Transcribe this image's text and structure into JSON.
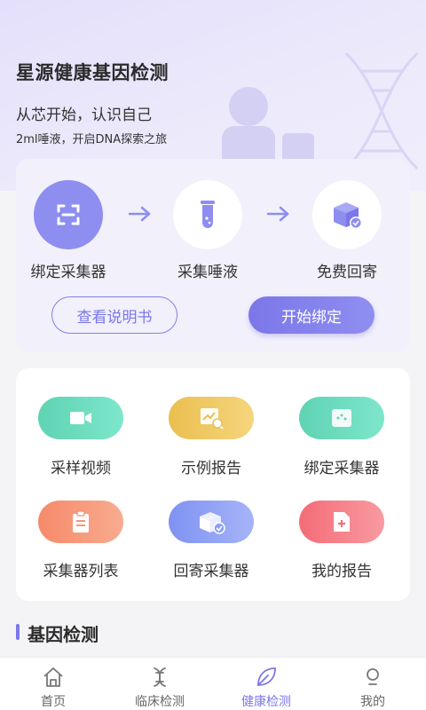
{
  "hero": {
    "title": "星源健康基因检测",
    "subtitle": "从芯开始，认识自己",
    "tagline": "2ml唾液，开启DNA探索之旅"
  },
  "bind_steps": [
    {
      "label": "绑定采集器",
      "icon": "scan-icon"
    },
    {
      "label": "采集唾液",
      "icon": "test-tube-icon"
    },
    {
      "label": "免费回寄",
      "icon": "box-check-icon"
    }
  ],
  "bind_actions": {
    "manual_label": "查看说明书",
    "start_label": "开始绑定"
  },
  "grid": [
    {
      "label": "采样视频",
      "icon": "video-icon",
      "colors": [
        "#5fd3b3",
        "#7ee6cb"
      ]
    },
    {
      "label": "示例报告",
      "icon": "report-chart-icon",
      "colors": [
        "#eabf4f",
        "#f5d57e"
      ]
    },
    {
      "label": "绑定采集器",
      "icon": "collector-icon",
      "colors": [
        "#5fd3b3",
        "#7ee6cb"
      ]
    },
    {
      "label": "采集器列表",
      "icon": "clipboard-icon",
      "colors": [
        "#f58a6a",
        "#f9ab8f"
      ]
    },
    {
      "label": "回寄采集器",
      "icon": "box-return-icon",
      "colors": [
        "#7f92f2",
        "#a5b4f8"
      ]
    },
    {
      "label": "我的报告",
      "icon": "document-plus-icon",
      "colors": [
        "#f46c77",
        "#f89aa1"
      ]
    }
  ],
  "section": {
    "title": "基因检测"
  },
  "tabbar": [
    {
      "label": "首页",
      "icon": "home-icon",
      "active": false
    },
    {
      "label": "临床检测",
      "icon": "clinical-icon",
      "active": false
    },
    {
      "label": "健康检测",
      "icon": "leaf-icon",
      "active": true
    },
    {
      "label": "我的",
      "icon": "profile-icon",
      "active": false
    }
  ],
  "colors": {
    "accent": "#7b77e9",
    "hero_bg": "#e4e0fb",
    "card_bg": "#f1f0fb"
  }
}
